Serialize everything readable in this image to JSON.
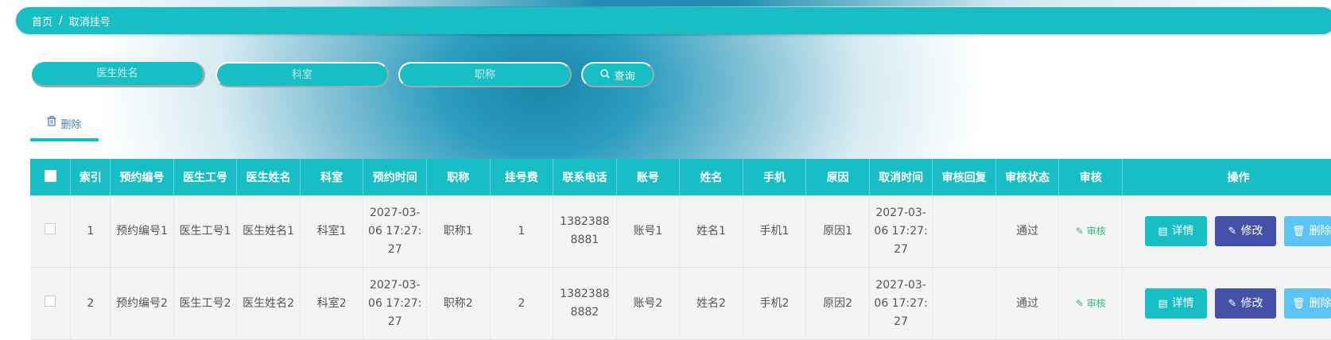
{
  "breadcrumb": {
    "home": "首页",
    "separator": "/",
    "current": "取消挂号"
  },
  "search": {
    "doctor_name_placeholder": "医生姓名",
    "department_placeholder": "科室",
    "title_placeholder": "职称",
    "query_label": "查询",
    "query_icon": "search-icon"
  },
  "actions": {
    "delete_label": "删除",
    "delete_icon": "trash-icon"
  },
  "table": {
    "headers": [
      "索引",
      "预约编号",
      "医生工号",
      "医生姓名",
      "科室",
      "预约时间",
      "职称",
      "挂号费",
      "联系电话",
      "账号",
      "姓名",
      "手机",
      "原因",
      "取消时间",
      "审核回复",
      "审核状态",
      "审核",
      "操作"
    ],
    "rows": [
      {
        "index": "1",
        "booking_no": "预约编号1",
        "doctor_id": "医生工号1",
        "doctor_name": "医生姓名1",
        "department": "科室1",
        "booking_time": "2027-03-06 17:27:27",
        "title": "职称1",
        "fee": "1",
        "phone": "13823888881",
        "account": "账号1",
        "name": "姓名1",
        "mobile": "手机1",
        "reason": "原因1",
        "cancel_time": "2027-03-06 17:27:27",
        "reply": "",
        "status": "通过",
        "audit": "审核",
        "detail": "详情",
        "edit": "修改",
        "delete": "删除"
      },
      {
        "index": "2",
        "booking_no": "预约编号2",
        "doctor_id": "医生工号2",
        "doctor_name": "医生姓名2",
        "department": "科室2",
        "booking_time": "2027-03-06 17:27:27",
        "title": "职称2",
        "fee": "2",
        "phone": "13823888882",
        "account": "账号2",
        "name": "姓名2",
        "mobile": "手机2",
        "reason": "原因2",
        "cancel_time": "2027-03-06 17:27:27",
        "reply": "",
        "status": "通过",
        "audit": "审核",
        "detail": "详情",
        "edit": "修改",
        "delete": "删除"
      }
    ]
  },
  "colors": {
    "primary": "#17bfc4",
    "edit": "#4550a8",
    "delete": "#5cc4f5",
    "audit": "#2bbf7a"
  }
}
